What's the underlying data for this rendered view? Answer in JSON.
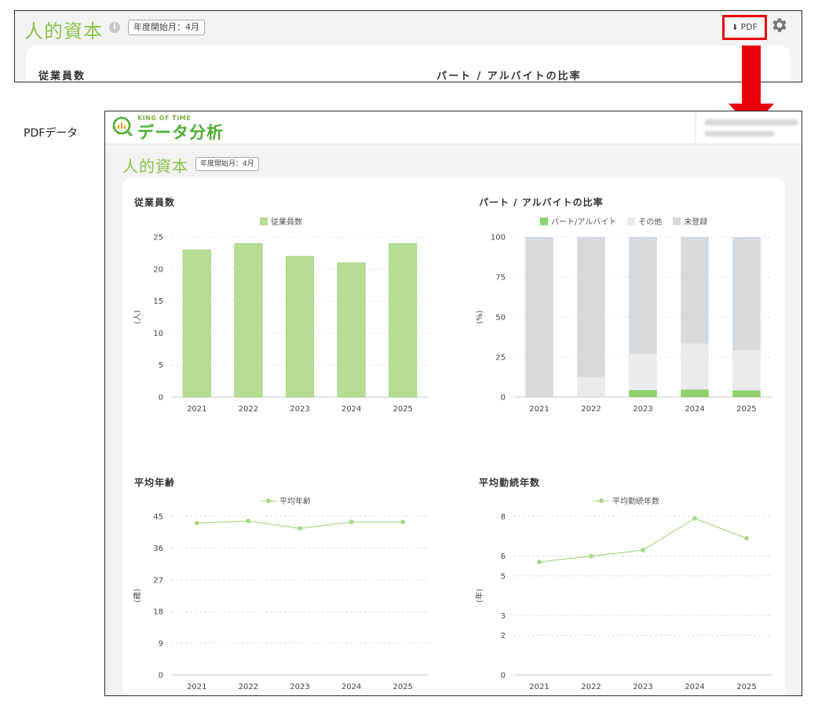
{
  "top_screen": {
    "title": "人的資本",
    "info_icon": "i",
    "fiscal_badge": "年度開始月：4月",
    "pdf_button": "PDF",
    "download_icon": "download-icon",
    "gear_icon": "gear-icon",
    "card_headings": [
      "従業員数",
      "パート / アルバイトの比率"
    ]
  },
  "side_label": "PDFデータ",
  "pdf": {
    "logo_small": "KING OF TIME",
    "logo_main": "データ分析",
    "title": "人的資本",
    "fiscal_badge": "年度開始月：4月"
  },
  "colors": {
    "accent": "#8bc34a",
    "bar_green": "#b5dd94",
    "bar_gray": "#d5dadf",
    "bar_lightgray": "#ebebee",
    "line_green": "#a8d98a",
    "highlight_red": "#e8000b"
  },
  "chart_data": [
    {
      "type": "bar",
      "title": "従業員数",
      "categories": [
        "2021",
        "2022",
        "2023",
        "2024",
        "2025"
      ],
      "series": [
        {
          "name": "従業員数",
          "values": [
            23,
            24,
            22,
            21,
            24
          ]
        }
      ],
      "ylabel": "(人)",
      "yticks": [
        0,
        5,
        10,
        15,
        20,
        25
      ],
      "ylim": [
        0,
        25
      ],
      "legend": "top"
    },
    {
      "type": "bar",
      "stacked": true,
      "title": "パート / アルバイトの比率",
      "categories": [
        "2021",
        "2022",
        "2023",
        "2024",
        "2025"
      ],
      "series": [
        {
          "name": "パート/アルバイト",
          "values": [
            0,
            0,
            4.5,
            4.8,
            4.2
          ]
        },
        {
          "name": "その他",
          "values": [
            0,
            12.5,
            22.7,
            28.6,
            25.0
          ]
        },
        {
          "name": "未登録",
          "values": [
            100,
            87.5,
            72.8,
            66.6,
            70.8
          ]
        }
      ],
      "ylabel": "(%)",
      "yticks": [
        0,
        25,
        50,
        75,
        100
      ],
      "ylim": [
        0,
        100
      ],
      "legend": "top"
    },
    {
      "type": "line",
      "title": "平均年齢",
      "categories": [
        "2021",
        "2022",
        "2023",
        "2024",
        "2025"
      ],
      "series": [
        {
          "name": "平均年齢",
          "values": [
            43.1,
            43.7,
            41.6,
            43.4,
            43.4
          ]
        }
      ],
      "ylabel": "(歳)",
      "yticks": [
        0,
        9,
        18,
        27,
        36,
        45
      ],
      "ylim": [
        0,
        45
      ],
      "legend": "top"
    },
    {
      "type": "line",
      "title": "平均勤続年数",
      "categories": [
        "2021",
        "2022",
        "2023",
        "2024",
        "2025"
      ],
      "series": [
        {
          "name": "平均勤続年数",
          "values": [
            5.7,
            6.0,
            6.3,
            7.9,
            6.9
          ]
        }
      ],
      "ylabel": "(年)",
      "yticks": [
        0,
        2,
        3,
        5,
        6,
        8
      ],
      "ylim": [
        0,
        8
      ],
      "legend": "top"
    }
  ]
}
